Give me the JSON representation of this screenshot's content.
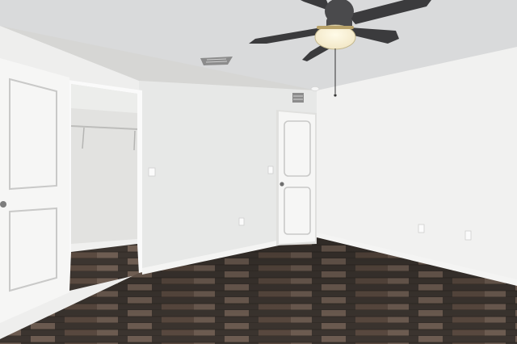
{
  "scene": {
    "subject": "empty-bedroom",
    "icons": [
      "ceiling-fan-icon",
      "air-vent-icon",
      "door-icon",
      "light-switch-icon",
      "power-outlet-icon"
    ]
  },
  "colors": {
    "ceiling": "#d9dadb",
    "wall_left": "#eeeeed",
    "wall_back": "#e7e8e7",
    "wall_right": "#f1f1f0",
    "door": "#f6f6f5",
    "door_panel_line": "#c9c9c8",
    "closet_interior": "#e2e2e0",
    "floor_dark": "#3c3530",
    "floor_mid": "#5a4a40",
    "floor_light": "#6e5d52",
    "baseboard": "#f4f4f3",
    "fan_blade": "#3b3b3d",
    "fan_housing": "#4a4a4c",
    "fan_globe": "#f2e7c6",
    "vent": "#8c8c8c"
  }
}
